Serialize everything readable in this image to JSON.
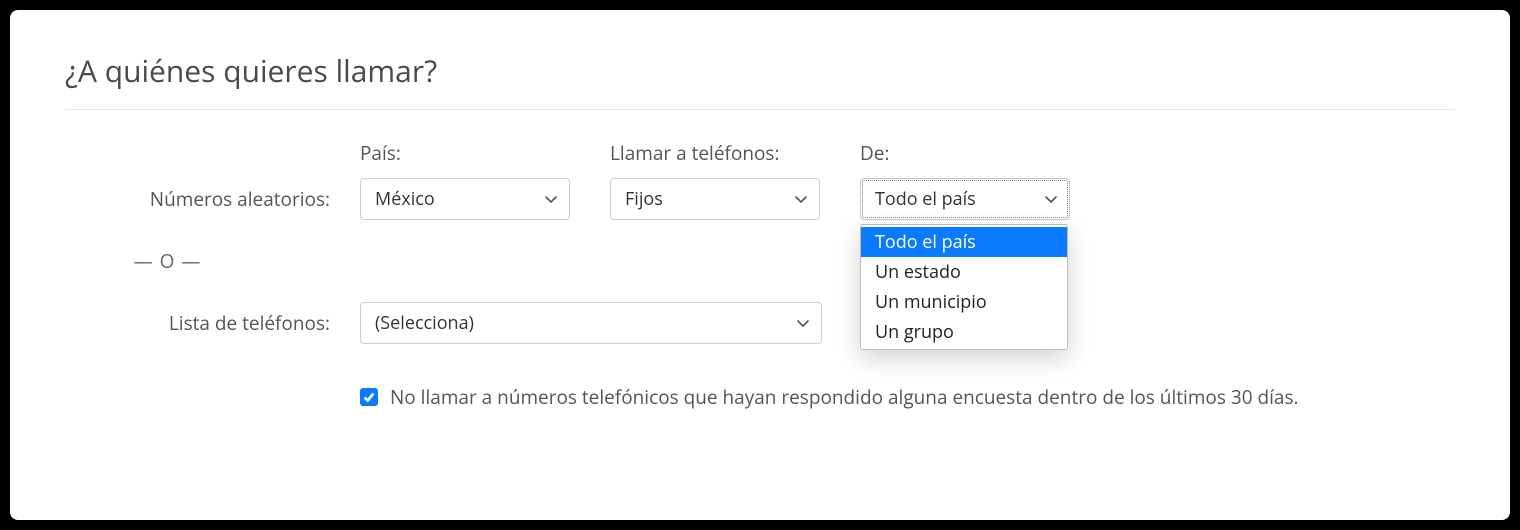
{
  "heading": "¿A quiénes quieres llamar?",
  "labels": {
    "country": "País:",
    "call_phones": "Llamar a teléfonos:",
    "from": "De:",
    "random_numbers": "Números aleatorios:",
    "or": "— O —",
    "phone_list": "Lista de teléfonos:"
  },
  "selects": {
    "country": "México",
    "phone_type": "Fijos",
    "from": "Todo el país",
    "phone_list": "(Selecciona)"
  },
  "from_options": [
    "Todo el país",
    "Un estado",
    "Un municipio",
    "Un grupo"
  ],
  "checkbox": {
    "label": "No llamar a números telefónicos que hayan respondido alguna encuesta dentro de los últimos 30 días.",
    "checked": true
  }
}
